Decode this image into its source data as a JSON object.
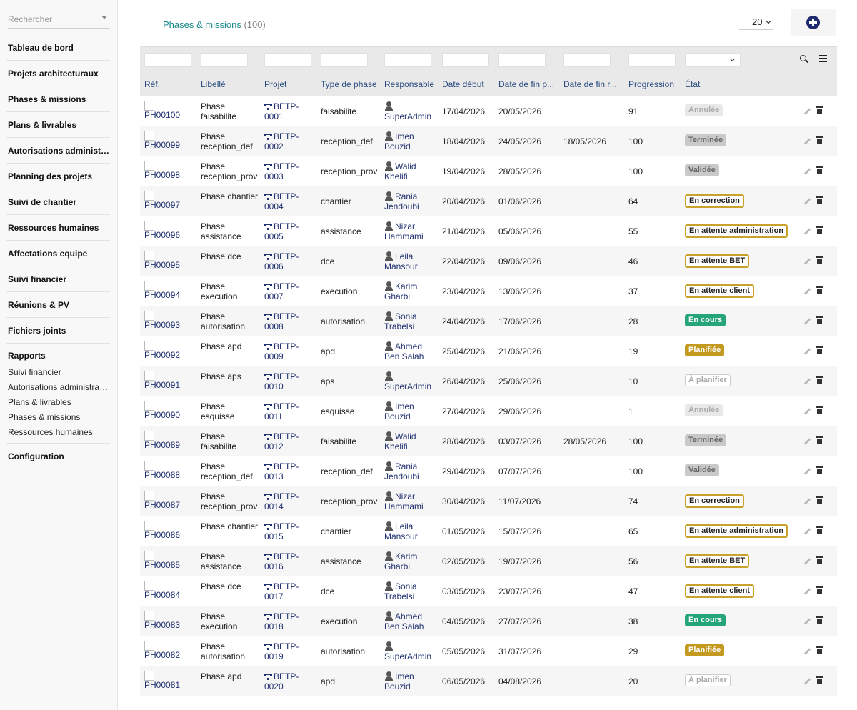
{
  "sidebar": {
    "search_placeholder": "Rechercher",
    "items": [
      {
        "label": "Tableau de bord"
      },
      {
        "label": "Projets architecturaux"
      },
      {
        "label": "Phases & missions"
      },
      {
        "label": "Plans & livrables"
      },
      {
        "label": "Autorisations administratives"
      },
      {
        "label": "Planning des projets"
      },
      {
        "label": "Suivi de chantier"
      },
      {
        "label": "Ressources humaines"
      },
      {
        "label": "Affectations equipe"
      },
      {
        "label": "Suivi financier"
      },
      {
        "label": "Réunions & PV"
      },
      {
        "label": "Fichiers joints"
      }
    ],
    "reports": {
      "label": "Rapports",
      "items": [
        "Suivi financier",
        "Autorisations administratives",
        "Plans & livrables",
        "Phases & missions",
        "Ressources humaines"
      ]
    },
    "config_label": "Configuration"
  },
  "header": {
    "title": "Phases & missions",
    "count": "(100)",
    "per_page": "20"
  },
  "table": {
    "columns": [
      "Réf.",
      "Libellé",
      "Projet",
      "Type de phase",
      "Responsable",
      "Date début",
      "Date de fin p...",
      "Date de fin r...",
      "Progression",
      "État"
    ],
    "rows": [
      {
        "ref": "PH00100",
        "libelle": "Phase faisabilite",
        "projet": "BETP-0001",
        "type": "faisabilite",
        "resp": "SuperAdmin",
        "debut": "17/04/2026",
        "finp": "20/05/2026",
        "finr": "",
        "prog": "91",
        "etat": "Annulée",
        "etat_style": "annulee"
      },
      {
        "ref": "PH00099",
        "libelle": "Phase reception_def",
        "projet": "BETP-0002",
        "type": "reception_def",
        "resp": "Imen Bouzid",
        "debut": "18/04/2026",
        "finp": "24/05/2026",
        "finr": "18/05/2026",
        "prog": "100",
        "etat": "Terminée",
        "etat_style": "terminee"
      },
      {
        "ref": "PH00098",
        "libelle": "Phase reception_prov",
        "projet": "BETP-0003",
        "type": "reception_prov",
        "resp": "Walid Khelifi",
        "debut": "19/04/2026",
        "finp": "28/05/2026",
        "finr": "",
        "prog": "100",
        "etat": "Validée",
        "etat_style": "validee"
      },
      {
        "ref": "PH00097",
        "libelle": "Phase chantier",
        "projet": "BETP-0004",
        "type": "chantier",
        "resp": "Rania Jendoubi",
        "debut": "20/04/2026",
        "finp": "01/06/2026",
        "finr": "",
        "prog": "64",
        "etat": "En correction",
        "etat_style": "outline"
      },
      {
        "ref": "PH00096",
        "libelle": "Phase assistance",
        "projet": "BETP-0005",
        "type": "assistance",
        "resp": "Nizar Hammami",
        "debut": "21/04/2026",
        "finp": "05/06/2026",
        "finr": "",
        "prog": "55",
        "etat": "En attente administration",
        "etat_style": "outline"
      },
      {
        "ref": "PH00095",
        "libelle": "Phase dce",
        "projet": "BETP-0006",
        "type": "dce",
        "resp": "Leila Mansour",
        "debut": "22/04/2026",
        "finp": "09/06/2026",
        "finr": "",
        "prog": "46",
        "etat": "En attente BET",
        "etat_style": "outline"
      },
      {
        "ref": "PH00094",
        "libelle": "Phase execution",
        "projet": "BETP-0007",
        "type": "execution",
        "resp": "Karim Gharbi",
        "debut": "23/04/2026",
        "finp": "13/06/2026",
        "finr": "",
        "prog": "37",
        "etat": "En attente client",
        "etat_style": "outline"
      },
      {
        "ref": "PH00093",
        "libelle": "Phase autorisation",
        "projet": "BETP-0008",
        "type": "autorisation",
        "resp": "Sonia Trabelsi",
        "debut": "24/04/2026",
        "finp": "17/06/2026",
        "finr": "",
        "prog": "28",
        "etat": "En cours",
        "etat_style": "encours"
      },
      {
        "ref": "PH00092",
        "libelle": "Phase apd",
        "projet": "BETP-0009",
        "type": "apd",
        "resp": "Ahmed Ben Salah",
        "debut": "25/04/2026",
        "finp": "21/06/2026",
        "finr": "",
        "prog": "19",
        "etat": "Planifiée",
        "etat_style": "planifiee"
      },
      {
        "ref": "PH00091",
        "libelle": "Phase aps",
        "projet": "BETP-0010",
        "type": "aps",
        "resp": "SuperAdmin",
        "debut": "26/04/2026",
        "finp": "25/06/2026",
        "finr": "",
        "prog": "10",
        "etat": "À planifier",
        "etat_style": "aplanifier"
      },
      {
        "ref": "PH00090",
        "libelle": "Phase esquisse",
        "projet": "BETP-0011",
        "type": "esquisse",
        "resp": "Imen Bouzid",
        "debut": "27/04/2026",
        "finp": "29/06/2026",
        "finr": "",
        "prog": "1",
        "etat": "Annulée",
        "etat_style": "annulee"
      },
      {
        "ref": "PH00089",
        "libelle": "Phase faisabilite",
        "projet": "BETP-0012",
        "type": "faisabilite",
        "resp": "Walid Khelifi",
        "debut": "28/04/2026",
        "finp": "03/07/2026",
        "finr": "28/05/2026",
        "prog": "100",
        "etat": "Terminée",
        "etat_style": "terminee"
      },
      {
        "ref": "PH00088",
        "libelle": "Phase reception_def",
        "projet": "BETP-0013",
        "type": "reception_def",
        "resp": "Rania Jendoubi",
        "debut": "29/04/2026",
        "finp": "07/07/2026",
        "finr": "",
        "prog": "100",
        "etat": "Validée",
        "etat_style": "validee"
      },
      {
        "ref": "PH00087",
        "libelle": "Phase reception_prov",
        "projet": "BETP-0014",
        "type": "reception_prov",
        "resp": "Nizar Hammami",
        "debut": "30/04/2026",
        "finp": "11/07/2026",
        "finr": "",
        "prog": "74",
        "etat": "En correction",
        "etat_style": "outline"
      },
      {
        "ref": "PH00086",
        "libelle": "Phase chantier",
        "projet": "BETP-0015",
        "type": "chantier",
        "resp": "Leila Mansour",
        "debut": "01/05/2026",
        "finp": "15/07/2026",
        "finr": "",
        "prog": "65",
        "etat": "En attente administration",
        "etat_style": "outline"
      },
      {
        "ref": "PH00085",
        "libelle": "Phase assistance",
        "projet": "BETP-0016",
        "type": "assistance",
        "resp": "Karim Gharbi",
        "debut": "02/05/2026",
        "finp": "19/07/2026",
        "finr": "",
        "prog": "56",
        "etat": "En attente BET",
        "etat_style": "outline"
      },
      {
        "ref": "PH00084",
        "libelle": "Phase dce",
        "projet": "BETP-0017",
        "type": "dce",
        "resp": "Sonia Trabelsi",
        "debut": "03/05/2026",
        "finp": "23/07/2026",
        "finr": "",
        "prog": "47",
        "etat": "En attente client",
        "etat_style": "outline"
      },
      {
        "ref": "PH00083",
        "libelle": "Phase execution",
        "projet": "BETP-0018",
        "type": "execution",
        "resp": "Ahmed Ben Salah",
        "debut": "04/05/2026",
        "finp": "27/07/2026",
        "finr": "",
        "prog": "38",
        "etat": "En cours",
        "etat_style": "encours"
      },
      {
        "ref": "PH00082",
        "libelle": "Phase autorisation",
        "projet": "BETP-0019",
        "type": "autorisation",
        "resp": "SuperAdmin",
        "debut": "05/05/2026",
        "finp": "31/07/2026",
        "finr": "",
        "prog": "29",
        "etat": "Planifiée",
        "etat_style": "planifiee"
      },
      {
        "ref": "PH00081",
        "libelle": "Phase apd",
        "projet": "BETP-0020",
        "type": "apd",
        "resp": "Imen Bouzid",
        "debut": "06/05/2026",
        "finp": "04/08/2026",
        "finr": "",
        "prog": "20",
        "etat": "À planifier",
        "etat_style": "aplanifier"
      }
    ]
  },
  "icons": {
    "search": "search-icon",
    "list": "list-icon",
    "add": "plus-circle-icon",
    "edit": "pencil-icon",
    "delete": "trash-icon",
    "project": "project-link-icon",
    "user": "user-icon"
  },
  "colors": {
    "accent_title": "#1a8a8a",
    "link": "#1f2f6f",
    "header_text": "#2b4d80",
    "status_encours": "#26a47a",
    "status_planifiee": "#c39a1f",
    "status_outline": "#c9a227"
  }
}
